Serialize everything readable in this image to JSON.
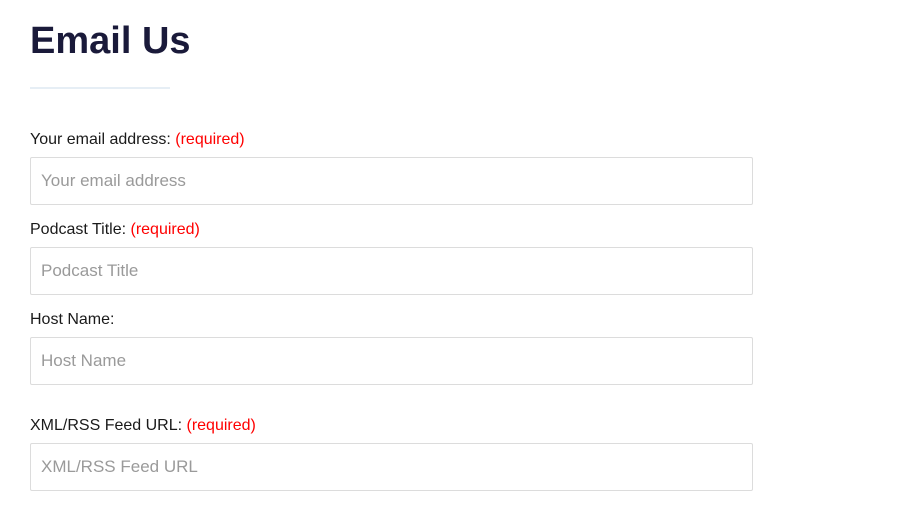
{
  "title": "Email Us",
  "required_label": "(required)",
  "fields": {
    "email": {
      "label": "Your email address: ",
      "placeholder": "Your email address",
      "required": true
    },
    "podcast_title": {
      "label": "Podcast Title: ",
      "placeholder": "Podcast Title",
      "required": true
    },
    "host_name": {
      "label": "Host Name:",
      "placeholder": "Host Name",
      "required": false
    },
    "feed_url": {
      "label": "XML/RSS Feed URL: ",
      "placeholder": "XML/RSS Feed URL",
      "required": true
    }
  }
}
